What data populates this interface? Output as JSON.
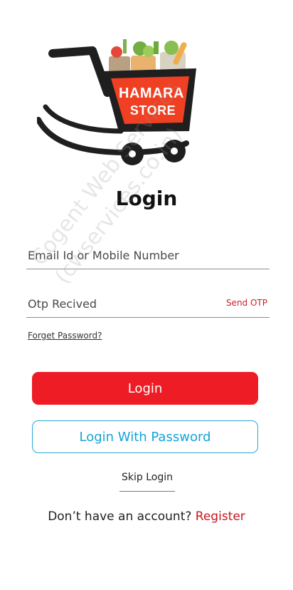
{
  "logo": {
    "line1": "HAMARA",
    "line2": "STORE",
    "colors": {
      "cart": "#1f1f1f",
      "badge": "#ef4023"
    }
  },
  "title": "Login",
  "email_field": {
    "placeholder": "Email Id or Mobile Number",
    "value": ""
  },
  "otp_field": {
    "placeholder": "Otp Recived",
    "value": "",
    "action_label": "Send OTP"
  },
  "forget_password": "Forget Password?",
  "login_button": "Login",
  "password_button": "Login With Password",
  "skip_login": "Skip Login",
  "account_prompt": {
    "text": "Don’t have an account?",
    "link": "Register"
  },
  "watermark": {
    "line1": "Cogent Web Services",
    "line2": "(cwservices.co.in)"
  },
  "colors": {
    "primary": "#ee1c24",
    "secondary": "#16a3d5",
    "text": "#222222"
  }
}
